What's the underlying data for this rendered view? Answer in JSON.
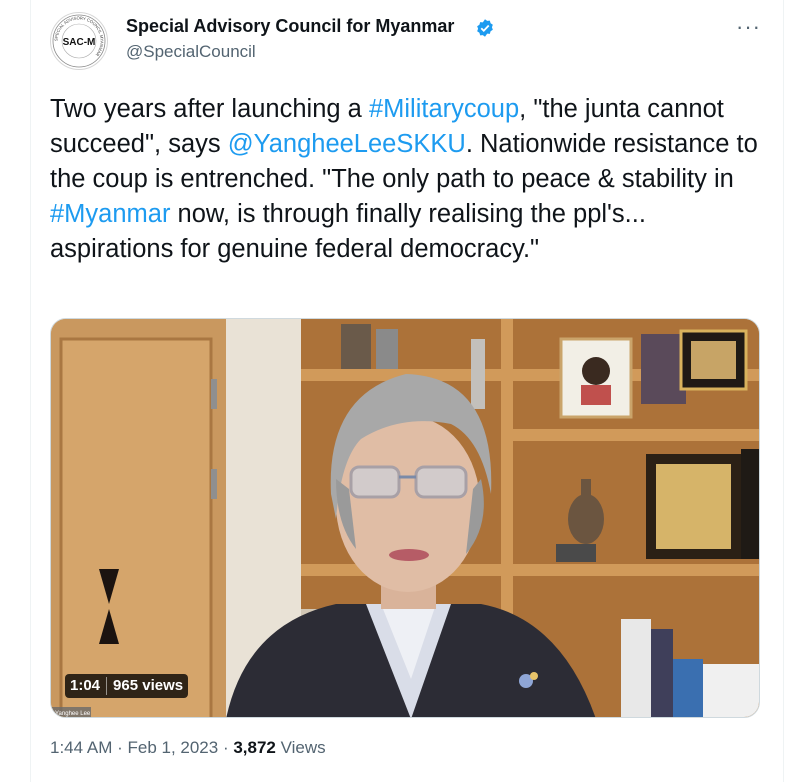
{
  "account": {
    "name": "Special Advisory Council for Myanmar",
    "handle": "@SpecialCouncil",
    "avatar_text": "SAC-M",
    "avatar_ring_text": "SPECIAL ADVISORY COUNCIL MYANMAR",
    "verified_icon": "verified-badge-icon",
    "verified_color": "#1d9bf0"
  },
  "more_label": "···",
  "tweet": {
    "p1": "Two years after launching a ",
    "h1": "#Militarycoup",
    "p2": ", \"the junta cannot succeed\", says ",
    "m1": "@YangheeLeeSKKU",
    "p3": ". Nationwide resistance to the coup is entrenched. \"The only path to peace & stability in ",
    "h2": "#Myanmar",
    "p4": " now, is through finally realising the ppl's... aspirations for genuine federal democracy.\""
  },
  "video": {
    "duration": "1:04",
    "views": "965 views",
    "caption": "Yanghee Lee"
  },
  "meta": {
    "time": "1:44 AM",
    "date": "Feb 1, 2023",
    "sep": " · ",
    "views_count": "3,872",
    "views_label": " Views"
  },
  "colors": {
    "link": "#1d9bf0",
    "secondary": "#536471",
    "text": "#0f1419"
  }
}
